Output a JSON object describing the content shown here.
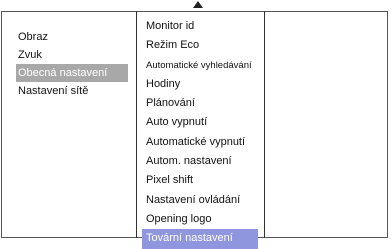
{
  "left_menu": {
    "items": [
      {
        "label": "Obraz"
      },
      {
        "label": "Zvuk"
      },
      {
        "label": "Obecná nastavení"
      },
      {
        "label": "Nastavení sítě"
      }
    ]
  },
  "right_menu": {
    "items": [
      {
        "label": "Monitor id"
      },
      {
        "label": "Režim Eco"
      },
      {
        "label": "Automatické vyhledávání"
      },
      {
        "label": "Hodiny"
      },
      {
        "label": "Plánování"
      },
      {
        "label": "Auto vypnutí"
      },
      {
        "label": "Automatické vypnutí"
      },
      {
        "label": "Autom. nastavení"
      },
      {
        "label": "Pixel shift"
      },
      {
        "label": "Nastavení ovládání"
      },
      {
        "label": "Opening  logo"
      },
      {
        "label": "Tovární nastavení"
      }
    ]
  }
}
